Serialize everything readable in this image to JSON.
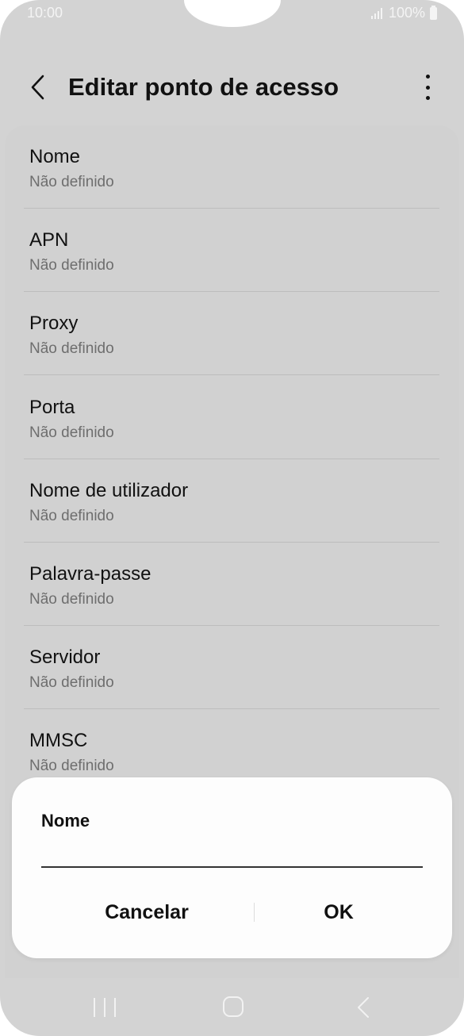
{
  "status_bar": {
    "time": "10:00",
    "battery": "100%"
  },
  "header": {
    "title": "Editar ponto de acesso"
  },
  "list": {
    "items": [
      {
        "title": "Nome",
        "value": "Não definido"
      },
      {
        "title": "APN",
        "value": "Não definido"
      },
      {
        "title": "Proxy",
        "value": "Não definido"
      },
      {
        "title": "Porta",
        "value": "Não definido"
      },
      {
        "title": "Nome de utilizador",
        "value": "Não definido"
      },
      {
        "title": "Palavra-passe",
        "value": "Não definido"
      },
      {
        "title": "Servidor",
        "value": "Não definido"
      },
      {
        "title": "MMSC",
        "value": "Não definido"
      }
    ]
  },
  "dialog": {
    "title": "Nome",
    "input_value": "",
    "cancel_label": "Cancelar",
    "ok_label": "OK"
  },
  "icons": {
    "back": "back-arrow-icon",
    "more": "more-vertical-icon",
    "signal": "signal-icon",
    "battery": "battery-icon",
    "nav_recents": "recent-apps-icon",
    "nav_home": "home-icon",
    "nav_back": "nav-back-icon"
  }
}
